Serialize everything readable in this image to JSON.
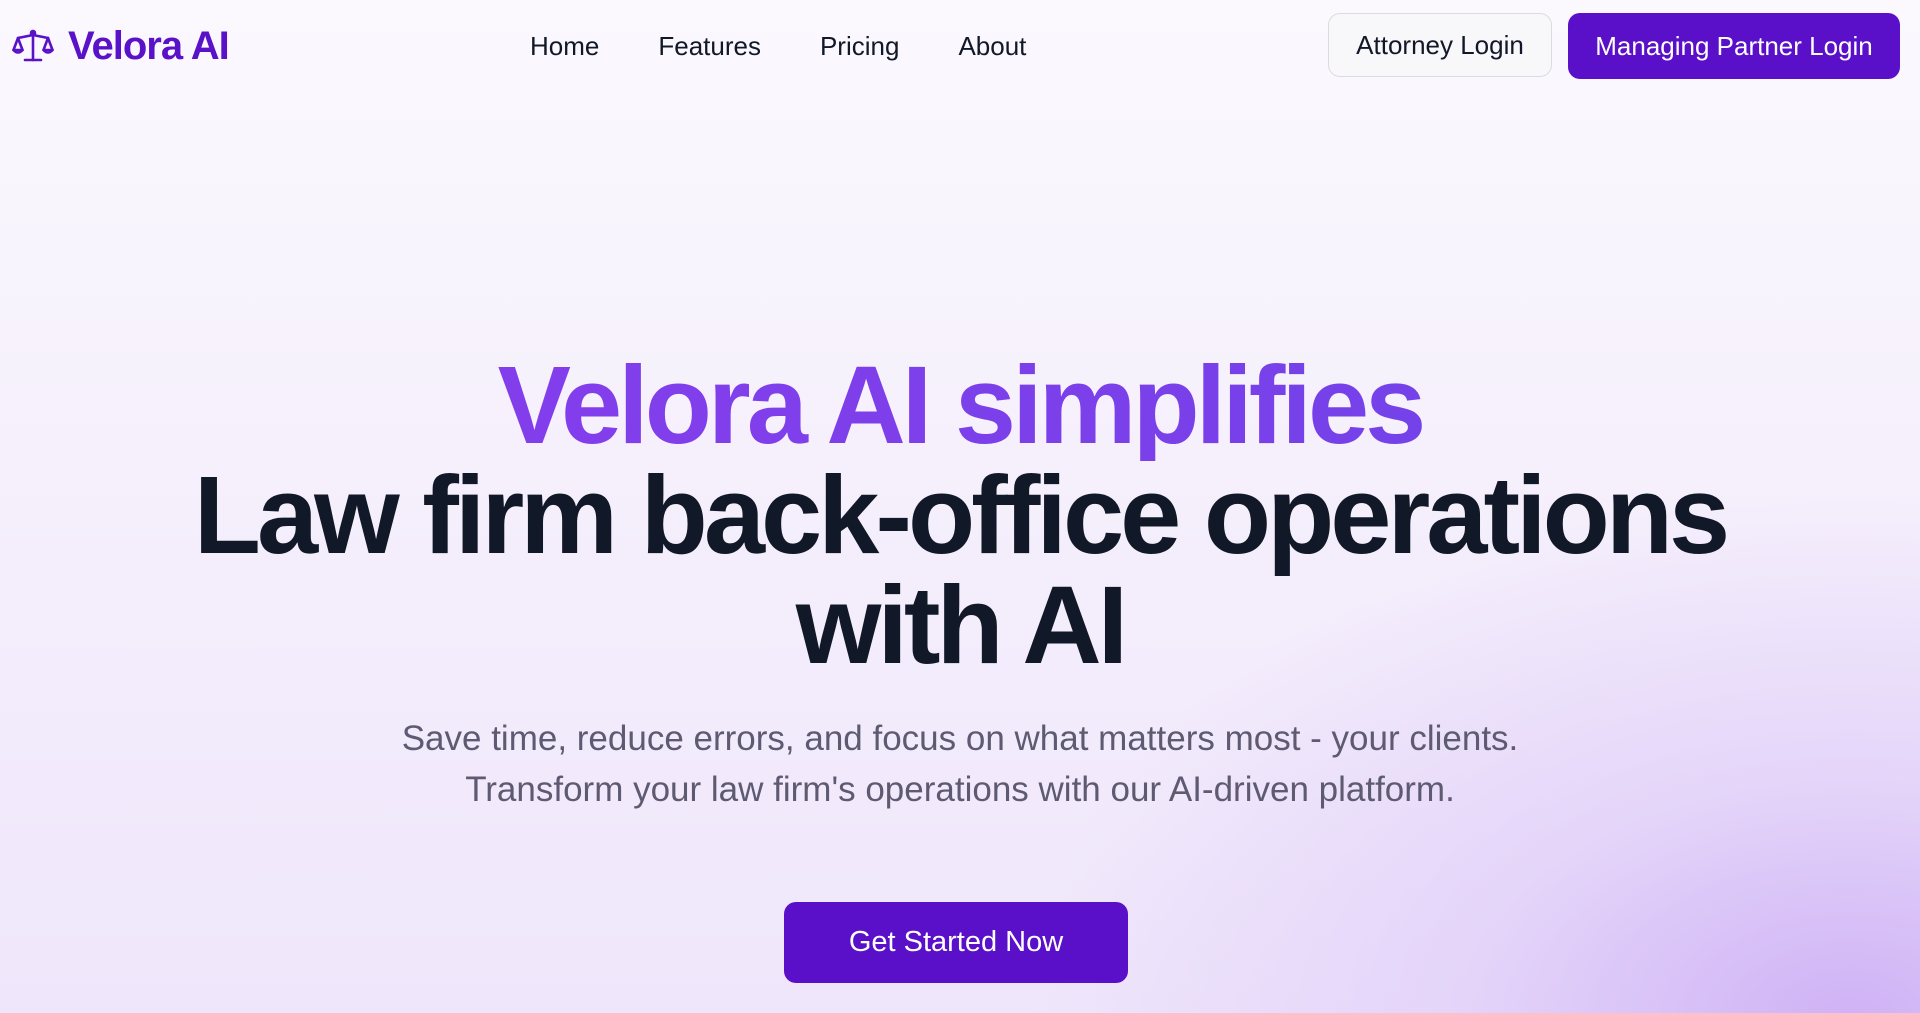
{
  "header": {
    "logo_text": "Velora AI",
    "logo_icon": "scales-of-justice-icon",
    "nav": [
      {
        "label": "Home"
      },
      {
        "label": "Features"
      },
      {
        "label": "Pricing"
      },
      {
        "label": "About"
      }
    ],
    "attorney_login_label": "Attorney Login",
    "partner_login_label": "Managing Partner Login"
  },
  "hero": {
    "headline_accent": "Velora AI simplifies",
    "headline_line2": "Law firm back-office operations",
    "headline_line3": "with AI",
    "subtitle_line1": "Save time, reduce errors, and focus on what matters most - your clients.",
    "subtitle_line2": "Transform your law firm's operations with our AI-driven platform.",
    "cta_label": "Get Started Now"
  },
  "colors": {
    "brand_purple": "#5a0fc8",
    "accent_gradient_start": "#8a3ded",
    "accent_gradient_end": "#6a45e6",
    "heading_dark": "#111827",
    "subtitle_gray": "#5d5a72"
  }
}
